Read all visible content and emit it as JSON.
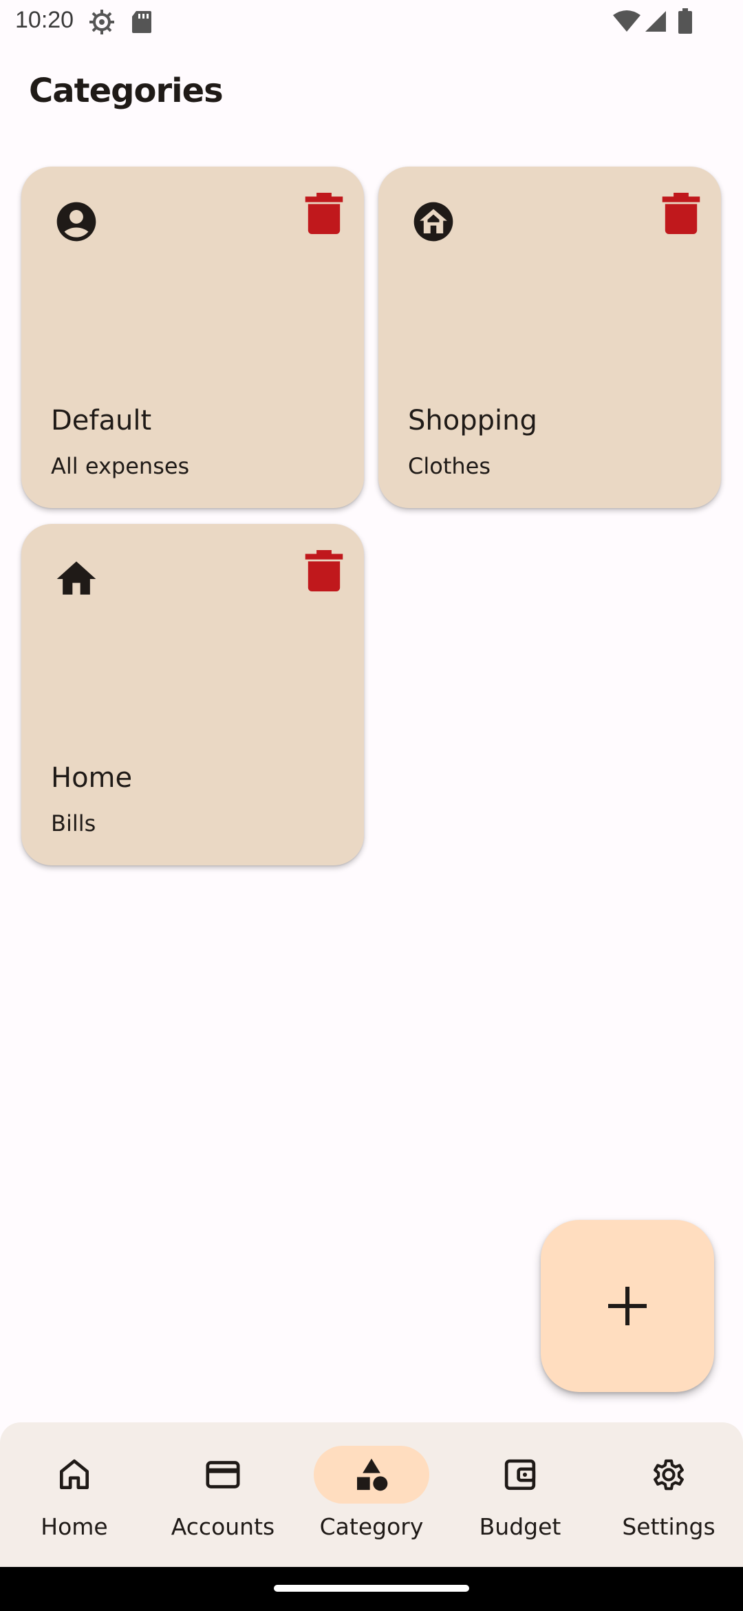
{
  "status_bar": {
    "time": "10:20"
  },
  "page": {
    "title": "Categories"
  },
  "categories": [
    {
      "name": "Default",
      "description": "All expenses",
      "icon": "account-circle-icon"
    },
    {
      "name": "Shopping",
      "description": "Clothes",
      "icon": "home-circle-icon"
    },
    {
      "name": "Home",
      "description": "Bills",
      "icon": "home-icon"
    }
  ],
  "colors": {
    "background": "#FFFBFE",
    "card": "#EAD8C4",
    "delete": "#C0181C",
    "fab": "#FFDDBF",
    "nav_background": "#F4EDE8",
    "nav_active_pill": "#FFDDBF",
    "text": "#1F1A17"
  },
  "fab": {
    "icon": "plus-icon"
  },
  "bottom_nav": {
    "items": [
      {
        "label": "Home",
        "icon": "home-outline-icon",
        "active": false
      },
      {
        "label": "Accounts",
        "icon": "credit-card-icon",
        "active": false
      },
      {
        "label": "Category",
        "icon": "category-shapes-icon",
        "active": true
      },
      {
        "label": "Budget",
        "icon": "wallet-icon",
        "active": false
      },
      {
        "label": "Settings",
        "icon": "gear-icon",
        "active": false
      }
    ]
  }
}
